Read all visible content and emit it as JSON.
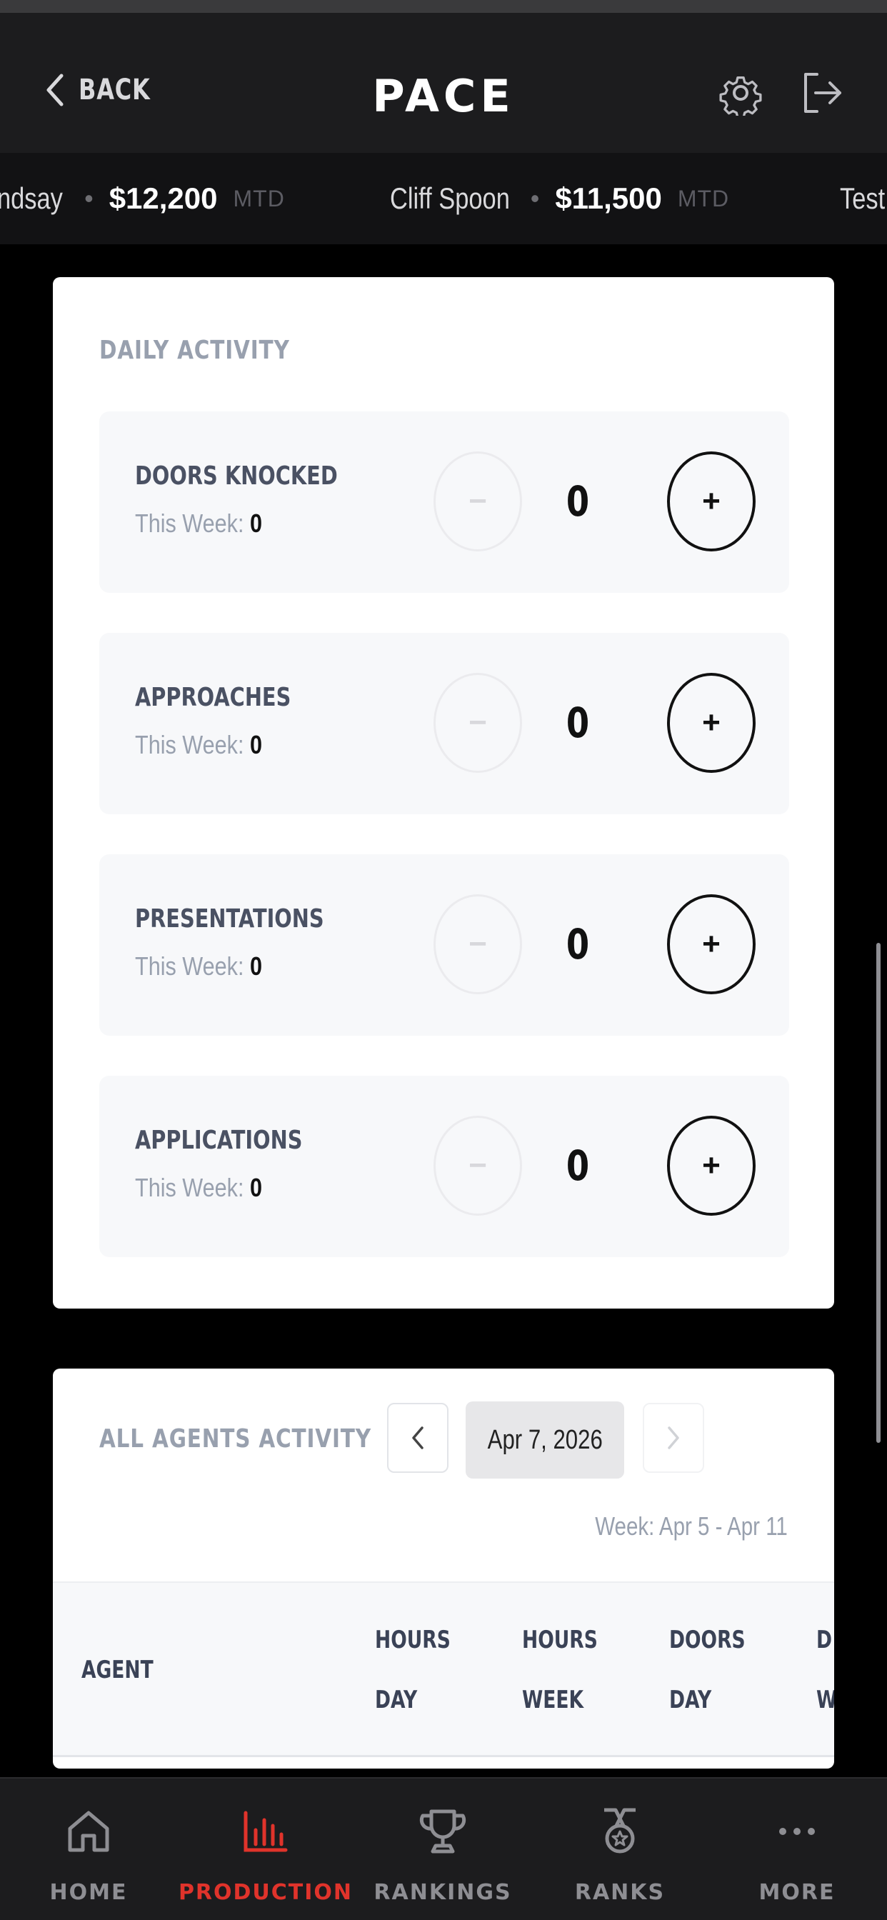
{
  "header": {
    "back_label": "BACK",
    "title": "PACE",
    "settings_icon": "gear-icon",
    "logout_icon": "logout-icon"
  },
  "ticker": [
    {
      "name": "ndsay",
      "amount": "$12,200",
      "suffix": "MTD"
    },
    {
      "name": "Cliff Spoon",
      "amount": "$11,500",
      "suffix": "MTD"
    },
    {
      "name": "Test",
      "amount": "",
      "suffix": ""
    }
  ],
  "daily_activity": {
    "title": "DAILY ACTIVITY",
    "week_prefix": "This Week:",
    "minus_symbol": "−",
    "plus_symbol": "+",
    "items": [
      {
        "label": "DOORS KNOCKED",
        "week_value": "0",
        "count": "0"
      },
      {
        "label": "APPROACHES",
        "week_value": "0",
        "count": "0"
      },
      {
        "label": "PRESENTATIONS",
        "week_value": "0",
        "count": "0"
      },
      {
        "label": "APPLICATIONS",
        "week_value": "0",
        "count": "0"
      }
    ]
  },
  "agents_activity": {
    "title": "ALL AGENTS ACTIVITY",
    "date": "Apr 7, 2026",
    "week_range": "Week: Apr 5 - Apr 11",
    "columns": [
      "AGENT",
      "HOURS\nDAY",
      "HOURS\nWEEK",
      "DOORS\nDAY",
      "D\nW"
    ]
  },
  "tabs": [
    {
      "label": "HOME",
      "icon": "home-icon",
      "active": false
    },
    {
      "label": "PRODUCTION",
      "icon": "bar-chart-icon",
      "active": true
    },
    {
      "label": "RANKINGS",
      "icon": "trophy-icon",
      "active": false
    },
    {
      "label": "RANKS",
      "icon": "medal-icon",
      "active": false
    },
    {
      "label": "MORE",
      "icon": "more-icon",
      "active": false
    }
  ],
  "colors": {
    "accent": "#e0332b",
    "header_bg": "#1c1c1e",
    "card_bg": "#ffffff"
  }
}
